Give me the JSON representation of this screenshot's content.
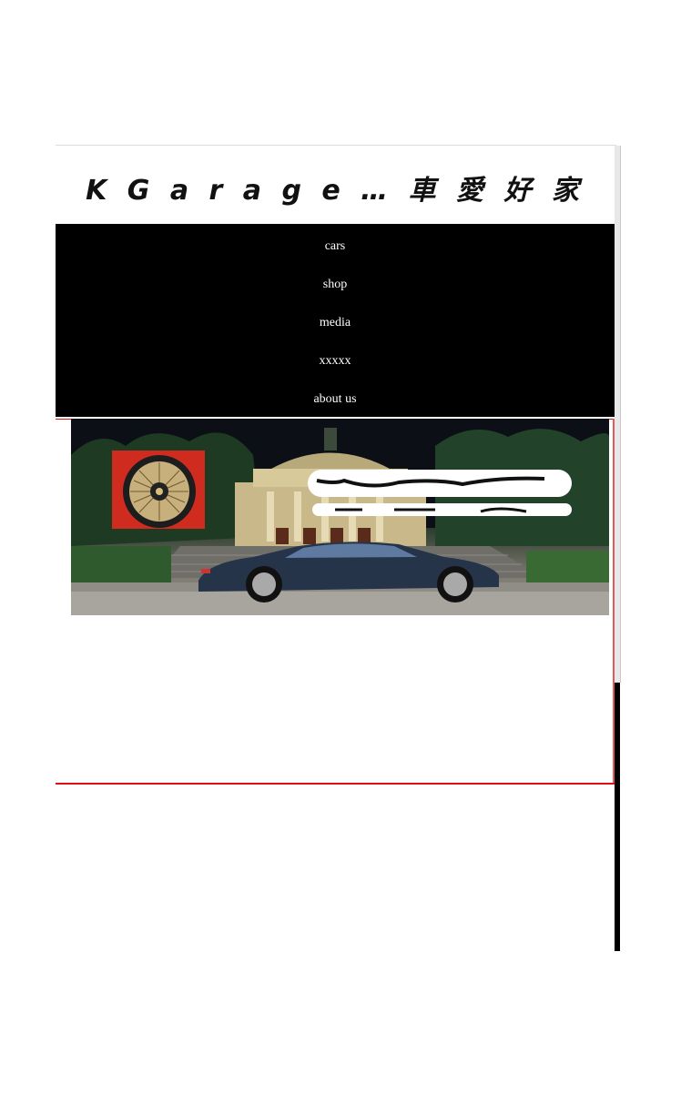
{
  "site": {
    "title": "K G a r a g e … 車 愛 好 家"
  },
  "nav": {
    "items": [
      {
        "label": "cars"
      },
      {
        "label": "shop"
      },
      {
        "label": "media"
      },
      {
        "label": "xxxxx"
      },
      {
        "label": "about us"
      }
    ]
  },
  "banner": {
    "main_image": "night-car-photo",
    "thumb_image": "wheel-photo"
  },
  "colors": {
    "nav_background": "#000000",
    "nav_text": "#ffffff",
    "accent_line": "#dd1111"
  }
}
